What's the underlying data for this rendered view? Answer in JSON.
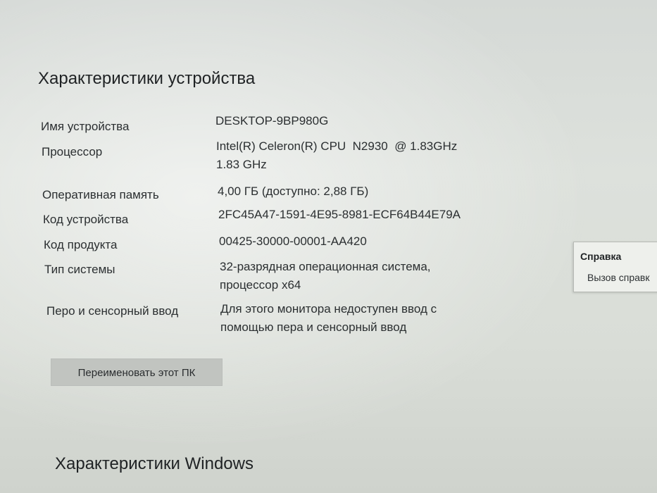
{
  "device_specs": {
    "title": "Характеристики устройства",
    "rows": [
      {
        "label": "Имя устройства",
        "value_lines": [
          "DESKTOP-9BP980G"
        ]
      },
      {
        "label": "Процессор",
        "value_lines": [
          "Intel(R) Celeron(R) CPU  N2930  @ 1.83GHz",
          "1.83 GHz"
        ]
      },
      {
        "label": "Оперативная память",
        "value_lines": [
          "4,00 ГБ (доступно: 2,88 ГБ)"
        ]
      },
      {
        "label": "Код устройства",
        "value_lines": [
          "2FC45A47-1591-4E95-8981-ECF64B44E79A"
        ]
      },
      {
        "label": "Код продукта",
        "value_lines": [
          "00425-30000-00001-AA420"
        ]
      },
      {
        "label": "Тип системы",
        "value_lines": [
          "32-разрядная операционная система,",
          "процессор x64"
        ]
      },
      {
        "label": "Перо и сенсорный ввод",
        "value_lines": [
          "Для этого монитора недоступен ввод с",
          "помощью пера и сенсорный ввод"
        ]
      }
    ],
    "rename_button": "Переименовать этот ПК"
  },
  "windows_specs": {
    "title": "Характеристики Windows"
  },
  "help": {
    "title": "Справка",
    "link": "Вызов справк"
  }
}
